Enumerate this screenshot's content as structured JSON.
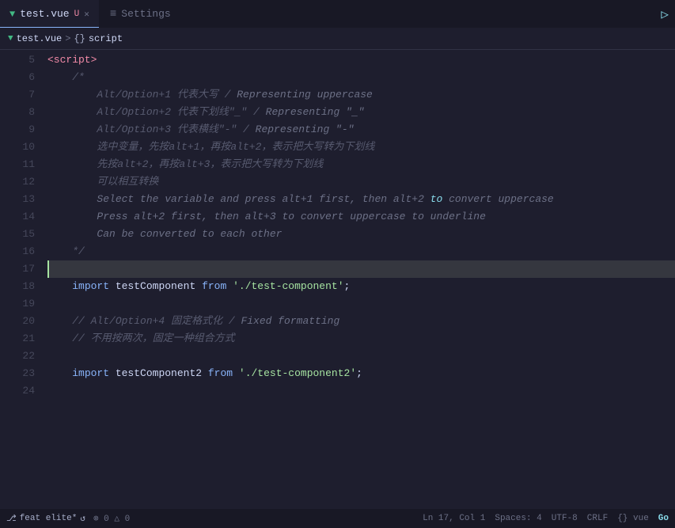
{
  "tabs": [
    {
      "id": "test-vue",
      "label": "test.vue",
      "modified": true,
      "active": true,
      "vue": true
    },
    {
      "id": "settings",
      "label": "Settings",
      "modified": false,
      "active": false,
      "vue": false
    }
  ],
  "run_button": "▷",
  "breadcrumb": {
    "file": "test.vue",
    "separator1": ">",
    "section": "{}",
    "section_label": "script"
  },
  "lines": [
    {
      "num": 5,
      "content": "<script>",
      "type": "tag"
    },
    {
      "num": 6,
      "content": "    /*",
      "type": "comment"
    },
    {
      "num": 7,
      "content": "        Alt/Option+1 代表大写 / Representing uppercase",
      "type": "comment"
    },
    {
      "num": 8,
      "content": "        Alt/Option+2 代表下划线\"_\" / Representing \"_\"",
      "type": "comment"
    },
    {
      "num": 9,
      "content": "        Alt/Option+3 代表横线\"-\" / Representing \"-\"",
      "type": "comment"
    },
    {
      "num": 10,
      "content": "        选中变量，先按alt+1，再按alt+2，表示把大写转为下划线",
      "type": "comment"
    },
    {
      "num": 11,
      "content": "        先按alt+2，再按alt+3，表示把大写转为下划线",
      "type": "comment"
    },
    {
      "num": 12,
      "content": "        可以相互转换",
      "type": "comment"
    },
    {
      "num": 13,
      "content": "        Select the variable and press alt+1 first, then alt+2 to convert uppercase",
      "type": "italic-comment"
    },
    {
      "num": 14,
      "content": "        Press alt+2 first, then alt+3 to convert uppercase to underline",
      "type": "italic-comment"
    },
    {
      "num": 15,
      "content": "        Can be converted to each other",
      "type": "italic-comment"
    },
    {
      "num": 16,
      "content": "    */",
      "type": "comment"
    },
    {
      "num": 17,
      "content": "",
      "type": "highlighted"
    },
    {
      "num": 18,
      "content": "    import testComponent from './test-component';",
      "type": "import"
    },
    {
      "num": 19,
      "content": "",
      "type": "plain"
    },
    {
      "num": 20,
      "content": "    // Alt/Option+4 固定格式化 / Fixed formatting",
      "type": "comment"
    },
    {
      "num": 21,
      "content": "    // 不用按两次，固定一种组合方式",
      "type": "comment"
    },
    {
      "num": 22,
      "content": "",
      "type": "plain"
    },
    {
      "num": 23,
      "content": "    import testComponent2 from './test-component2';",
      "type": "import"
    },
    {
      "num": 24,
      "content": "",
      "type": "plain"
    }
  ],
  "status": {
    "branch": "feat elite*",
    "sync_icon": "↺",
    "errors": "⊗ 0 △ 0",
    "position": "Ln 17, Col 1",
    "spaces": "Spaces: 4",
    "encoding": "UTF-8",
    "line_ending": "CRLF",
    "language": "{} vue",
    "go": "Go"
  }
}
